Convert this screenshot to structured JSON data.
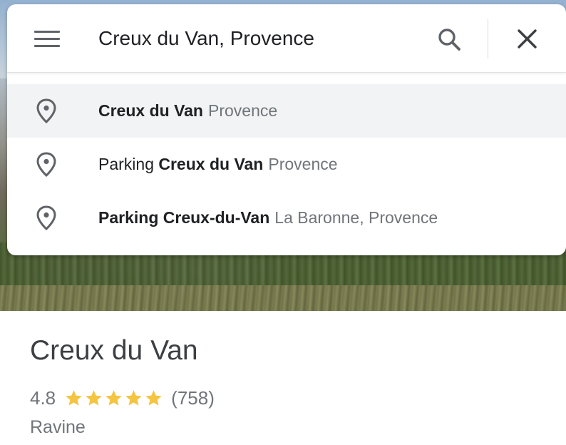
{
  "search": {
    "query": "Creux du Van, Provence",
    "menu_icon": "hamburger-menu-icon",
    "search_icon": "search-icon",
    "close_icon": "close-icon"
  },
  "suggestions": [
    {
      "pre": "",
      "bold": "Creux du Van",
      "post": "",
      "secondary": "Provence",
      "icon": "place-pin-icon",
      "highlighted": true
    },
    {
      "pre": "Parking ",
      "bold": "Creux du Van",
      "post": "",
      "secondary": "Provence",
      "icon": "place-pin-icon",
      "highlighted": false
    },
    {
      "pre": "",
      "bold": "Parking Creux-du-Van",
      "post": "",
      "secondary": "La Baronne, Provence",
      "icon": "place-pin-icon",
      "highlighted": false
    }
  ],
  "place": {
    "name": "Creux du Van",
    "rating": "4.8",
    "stars": 5,
    "reviews": "(758)",
    "category": "Ravine"
  },
  "colors": {
    "star": "#f4c542",
    "text_primary": "#202124",
    "text_secondary": "#70757a",
    "icon": "#5f6368",
    "highlight_row": "#f1f3f4"
  }
}
